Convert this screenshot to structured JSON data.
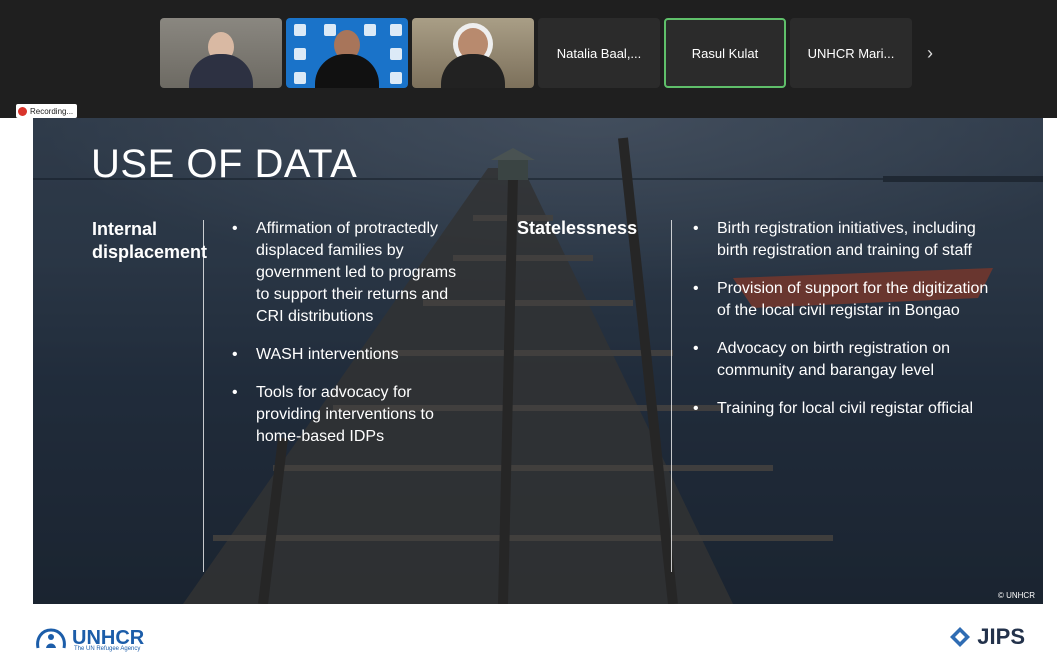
{
  "participants": {
    "names": [
      "Natalia Baal,...",
      "Rasul Kulat",
      "UNHCR Mari..."
    ],
    "more_icon": "chevron-right-icon"
  },
  "recording": {
    "label": "Recording..."
  },
  "slide": {
    "title": "USE OF DATA",
    "left": {
      "heading": "Internal displacement",
      "bullets": [
        "Affirmation of protractedly displaced families by government led to programs to support their returns and CRI distributions",
        "WASH interventions",
        "Tools for advocacy for providing interventions to home-based IDPs"
      ]
    },
    "right": {
      "heading": "Statelessness",
      "bullets": [
        "Birth registration initiatives, including birth registration and training of staff",
        "Provision of support for the digitization of the local civil registar in Bongao",
        "Advocacy on birth registration on community and barangay level",
        "Training for local civil registar official"
      ]
    },
    "credit": "© UNHCR",
    "footer": {
      "unhcr": "UNHCR",
      "unhcr_sub": "The UN Refugee Agency",
      "jips": "JIPS"
    }
  }
}
